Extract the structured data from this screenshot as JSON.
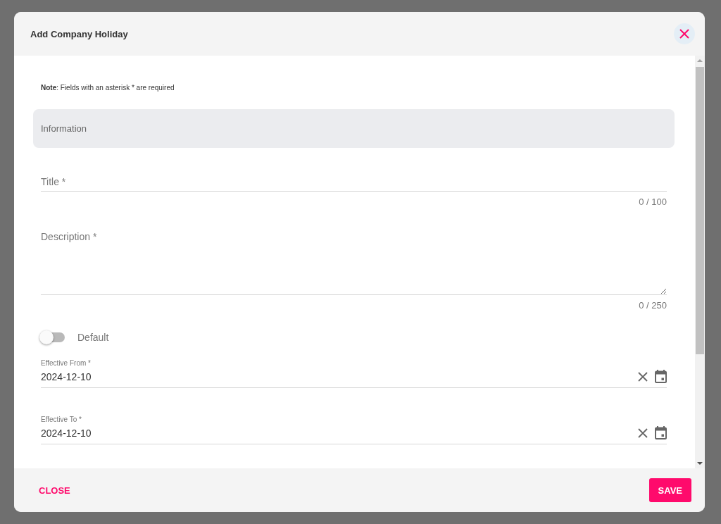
{
  "dialog": {
    "title": "Add Company Holiday"
  },
  "note": "**Note**: Fields with an asterisk * are required",
  "section": {
    "title": "Information"
  },
  "fields": [
    {
      "kind": "text",
      "placeholder": "Title *",
      "counter": "0 / 100"
    },
    {
      "kind": "textarea",
      "placeholder": "Description *",
      "counter": "0 / 250"
    },
    {
      "kind": "toggle",
      "label": "Default",
      "on": false
    },
    {
      "kind": "date",
      "label": "Effective From *",
      "value": "2024-12-10"
    },
    {
      "kind": "date",
      "label": "Effective To *",
      "value": "2024-12-10"
    }
  ],
  "footer": {
    "close": "CLOSE",
    "save": "SAVE"
  }
}
